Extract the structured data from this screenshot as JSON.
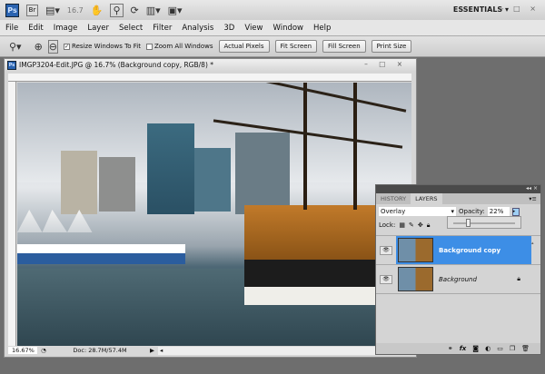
{
  "appbar": {
    "ps": "Ps",
    "br": "Br",
    "zoom": "16.7",
    "workspace": "ESSENTIALS ▾",
    "window_controls": "– □ ×"
  },
  "menu": [
    "File",
    "Edit",
    "Image",
    "Layer",
    "Select",
    "Filter",
    "Analysis",
    "3D",
    "View",
    "Window",
    "Help"
  ],
  "options": {
    "resize_label": "Resize Windows To Fit",
    "resize_checked": "✓",
    "zoom_all_label": "Zoom All Windows",
    "actual_pixels": "Actual Pixels",
    "fit_screen": "Fit Screen",
    "fill_screen": "Fill Screen",
    "print_size": "Print Size"
  },
  "document": {
    "title": "IMGP3204-Edit.JPG @ 16.7% (Background copy, RGB/8) *",
    "controls": "– □ ×",
    "zoom": "16.67%",
    "doc_size": "Doc: 28.7M/57.4M"
  },
  "layers_panel": {
    "tabs": [
      "HISTORY",
      "LAYERS"
    ],
    "blend_mode": "Overlay",
    "opacity_label": "Opacity:",
    "opacity": "22%",
    "opacity_fraction": 0.22,
    "lock_label": "Lock:",
    "collapse": "◂◂ ×",
    "layers": [
      {
        "name": "Background copy",
        "selected": true
      },
      {
        "name": "Background",
        "locked": true
      }
    ],
    "footer_icons": [
      "link-icon",
      "fx-icon",
      "mask-icon",
      "adjustment-icon",
      "folder-icon",
      "new-layer-icon",
      "trash-icon"
    ],
    "fx": "fx"
  },
  "colors": {
    "selection": "#3d8ee6"
  }
}
